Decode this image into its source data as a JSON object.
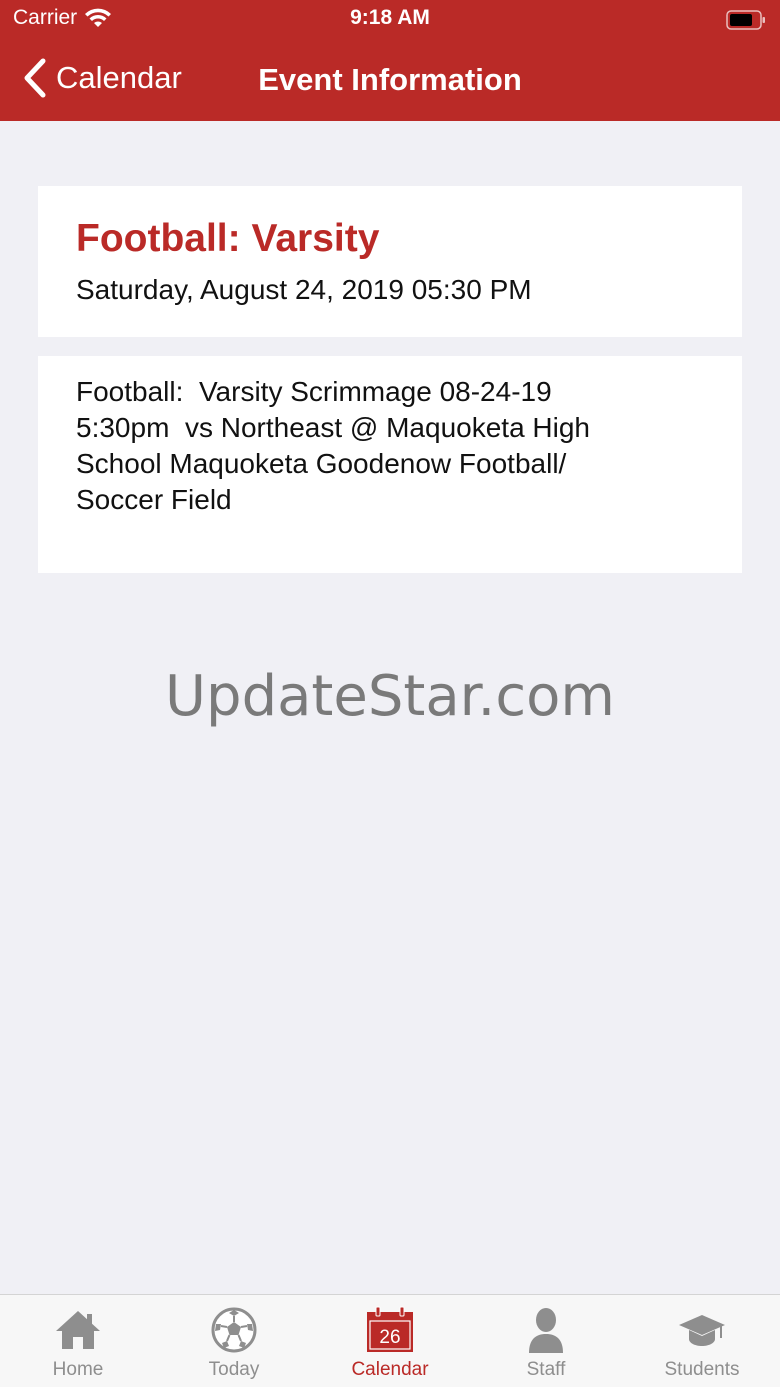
{
  "status_bar": {
    "carrier": "Carrier",
    "time": "9:18 AM"
  },
  "nav": {
    "back_label": "Calendar",
    "title": "Event Information"
  },
  "event": {
    "title": "Football: Varsity",
    "date": "Saturday, August 24, 2019 05:30 PM",
    "description": "Football:  Varsity Scrimmage 08-24-19\n5:30pm  vs Northeast @ Maquoketa High\nSchool Maquoketa Goodenow Football/\nSoccer Field"
  },
  "watermark": "UpdateStar.com",
  "tabs": [
    {
      "label": "Home",
      "icon": "home-icon"
    },
    {
      "label": "Today",
      "icon": "soccer-ball-icon"
    },
    {
      "label": "Calendar",
      "icon": "calendar-icon",
      "calendar_day": "26",
      "active": true
    },
    {
      "label": "Staff",
      "icon": "person-icon"
    },
    {
      "label": "Students",
      "icon": "graduation-cap-icon"
    }
  ],
  "colors": {
    "brand": "#ba2a27",
    "background": "#f0f0f5",
    "tab_inactive": "#8e8e8e"
  }
}
